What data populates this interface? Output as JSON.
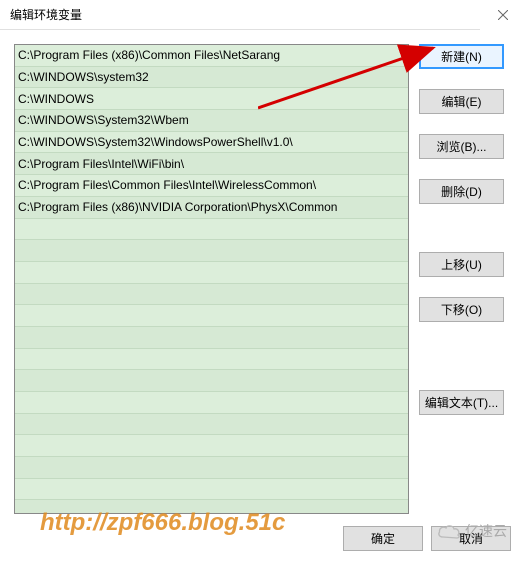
{
  "title": "编辑环境变量",
  "close_label": "×",
  "list_items": [
    "C:\\Program Files (x86)\\Common Files\\NetSarang",
    "C:\\WINDOWS\\system32",
    "C:\\WINDOWS",
    "C:\\WINDOWS\\System32\\Wbem",
    "C:\\WINDOWS\\System32\\WindowsPowerShell\\v1.0\\",
    "C:\\Program Files\\Intel\\WiFi\\bin\\",
    "C:\\Program Files\\Common Files\\Intel\\WirelessCommon\\",
    "C:\\Program Files (x86)\\NVIDIA Corporation\\PhysX\\Common"
  ],
  "buttons": {
    "new": "新建(N)",
    "edit": "编辑(E)",
    "browse": "浏览(B)...",
    "delete": "删除(D)",
    "move_up": "上移(U)",
    "move_down": "下移(O)",
    "edit_text": "编辑文本(T)..."
  },
  "footer": {
    "ok": "确定",
    "cancel": "取消"
  },
  "watermark": "http://zpf666.blog.51c",
  "brand": "亿速云"
}
